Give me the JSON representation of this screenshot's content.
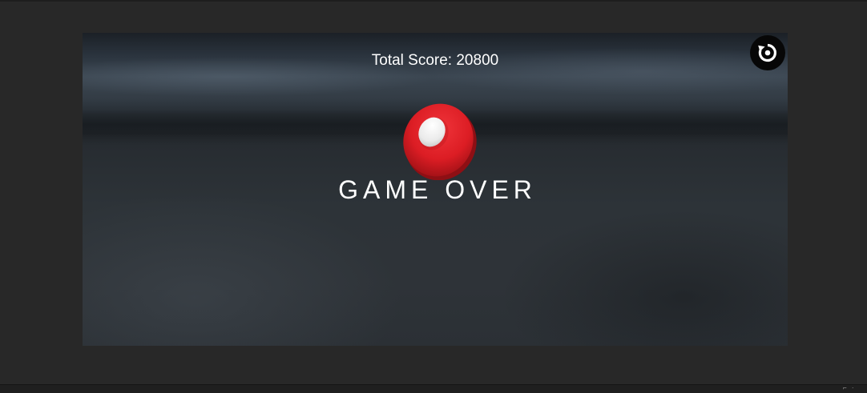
{
  "hud": {
    "total_score_label": "Total Score: 20800",
    "game_over_label": "GAME OVER"
  },
  "controls": {
    "restart_icon": "restart-icon"
  },
  "logo": {
    "icon": "red-disc-logo-icon",
    "colors": {
      "disc": "#e31e24",
      "highlight": "#f2f2f2"
    }
  },
  "colors": {
    "editor_background": "#282828",
    "text": "#ffffff",
    "restart_button": "#070707"
  }
}
